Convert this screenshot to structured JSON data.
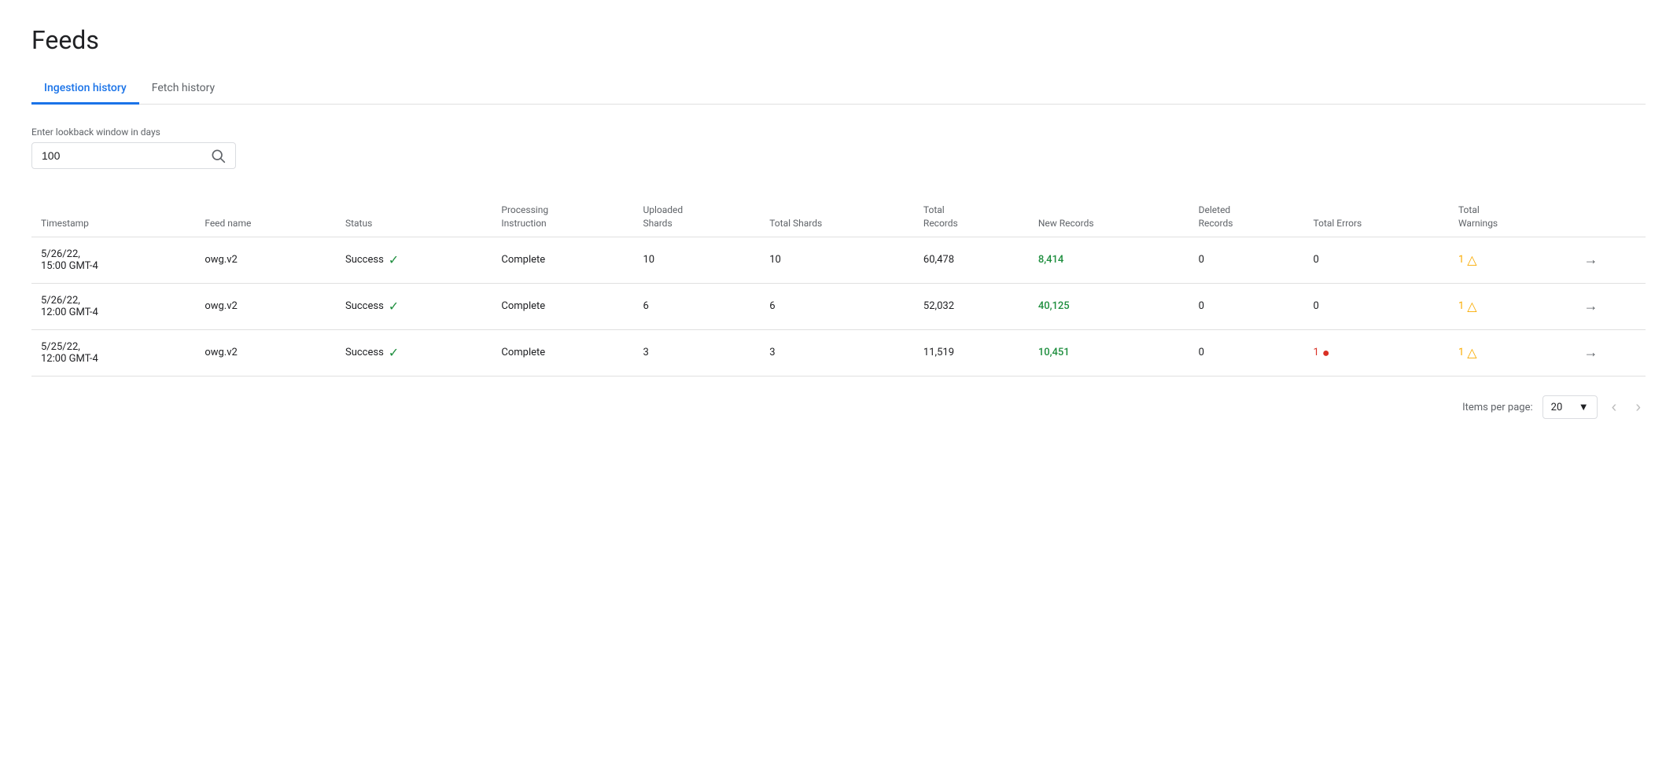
{
  "page": {
    "title": "Feeds"
  },
  "tabs": [
    {
      "id": "ingestion",
      "label": "Ingestion history",
      "active": true
    },
    {
      "id": "fetch",
      "label": "Fetch history",
      "active": false
    }
  ],
  "search": {
    "label": "Enter lookback window in days",
    "value": "100",
    "placeholder": ""
  },
  "table": {
    "columns": [
      {
        "id": "timestamp",
        "label": "Timestamp"
      },
      {
        "id": "feed_name",
        "label": "Feed name"
      },
      {
        "id": "status",
        "label": "Status"
      },
      {
        "id": "processing_instruction",
        "label": "Processing\nInstruction"
      },
      {
        "id": "uploaded_shards",
        "label": "Uploaded\nShards"
      },
      {
        "id": "total_shards",
        "label": "Total Shards"
      },
      {
        "id": "total_records",
        "label": "Total\nRecords"
      },
      {
        "id": "new_records",
        "label": "New Records"
      },
      {
        "id": "deleted_records",
        "label": "Deleted\nRecords"
      },
      {
        "id": "total_errors",
        "label": "Total Errors"
      },
      {
        "id": "total_warnings",
        "label": "Total\nWarnings"
      },
      {
        "id": "action",
        "label": ""
      }
    ],
    "rows": [
      {
        "timestamp": "5/26/22,\n15:00 GMT-4",
        "feed_name": "owg.v2",
        "status": "Success",
        "processing_instruction": "Complete",
        "uploaded_shards": "10",
        "total_shards": "10",
        "total_records": "60,478",
        "new_records": "8,414",
        "deleted_records": "0",
        "total_errors": "0",
        "total_warnings": "1",
        "has_warning": true,
        "has_error": false,
        "error_count": ""
      },
      {
        "timestamp": "5/26/22,\n12:00 GMT-4",
        "feed_name": "owg.v2",
        "status": "Success",
        "processing_instruction": "Complete",
        "uploaded_shards": "6",
        "total_shards": "6",
        "total_records": "52,032",
        "new_records": "40,125",
        "deleted_records": "0",
        "total_errors": "0",
        "total_warnings": "1",
        "has_warning": true,
        "has_error": false,
        "error_count": ""
      },
      {
        "timestamp": "5/25/22,\n12:00 GMT-4",
        "feed_name": "owg.v2",
        "status": "Success",
        "processing_instruction": "Complete",
        "uploaded_shards": "3",
        "total_shards": "3",
        "total_records": "11,519",
        "new_records": "10,451",
        "deleted_records": "0",
        "total_errors": "1",
        "total_warnings": "1",
        "has_warning": true,
        "has_error": true,
        "error_count": "1"
      }
    ]
  },
  "pagination": {
    "items_per_page_label": "Items per page:",
    "items_per_page_value": "20"
  }
}
